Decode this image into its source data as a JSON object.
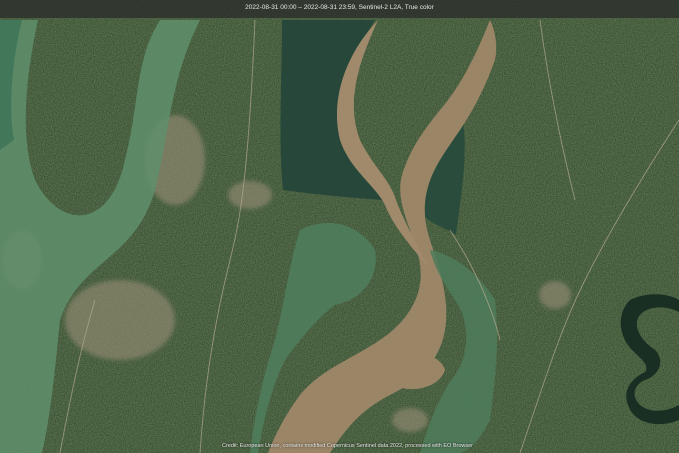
{
  "title": "2022-08-31 00:00 – 2022-08-31 23:59, Sentinel-2 L2A, True color",
  "credit": "Credit: European Union, contains modified Copernicus Sentinel data 2022, processed with EO Browser",
  "colors": {
    "land_dark_green": "#2d4a2b",
    "land_tan": "#8e8266",
    "flood_water_brown": "#9a8466",
    "flooded_field_green": "#4f7d5c",
    "deep_water_dark": "#1f3a2c"
  }
}
